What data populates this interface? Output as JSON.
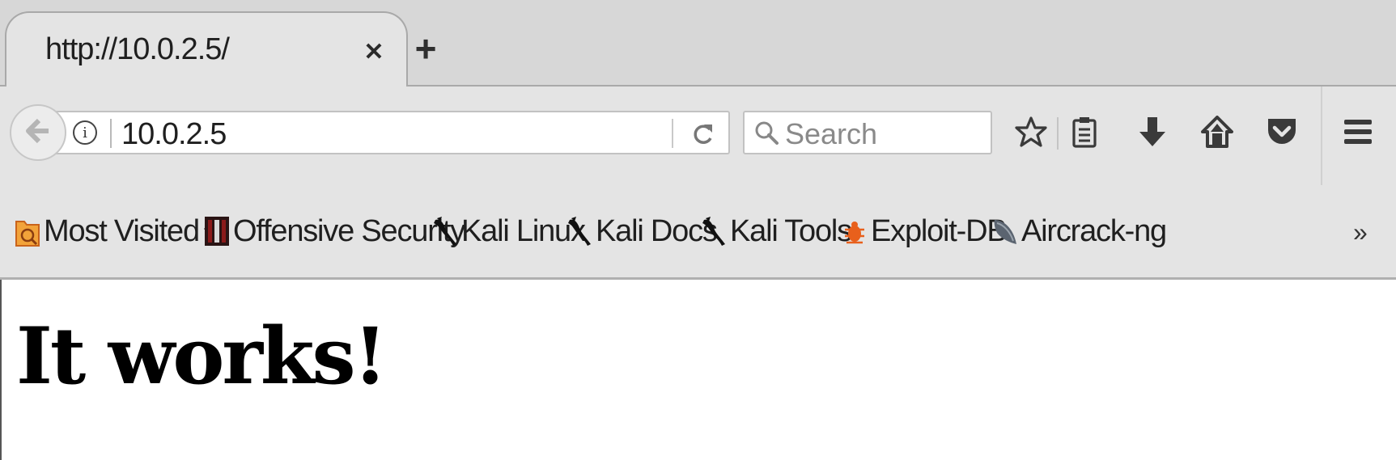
{
  "tab": {
    "title": "http://10.0.2.5/",
    "close_icon": "close-icon",
    "new_tab_icon": "plus-icon"
  },
  "navbar": {
    "url": "10.0.2.5",
    "search_placeholder": "Search",
    "icons": [
      "back-arrow-icon",
      "info-icon",
      "reload-icon",
      "search-icon",
      "star-icon",
      "clipboard-icon",
      "download-icon",
      "home-icon",
      "pocket-icon",
      "hamburger-menu-icon"
    ]
  },
  "bookmarks": {
    "items": [
      {
        "label": "Most Visited",
        "icon": "most-visited-icon"
      },
      {
        "label": "Offensive Security",
        "icon": "offensive-security-icon"
      },
      {
        "label": "Kali Linux",
        "icon": "kali-dragon-icon"
      },
      {
        "label": "Kali Docs",
        "icon": "kali-dragon-icon"
      },
      {
        "label": "Kali Tools",
        "icon": "kali-dragon-icon"
      },
      {
        "label": "Exploit-DB",
        "icon": "exploit-db-bug-icon"
      },
      {
        "label": "Aircrack-ng",
        "icon": "aircrack-icon"
      }
    ],
    "overflow": "»"
  },
  "page": {
    "heading": "It works!"
  },
  "colors": {
    "chrome": "#e4e4e4",
    "tabstrip": "#d7d7d7",
    "exploit_orange": "#e8601c",
    "most_visited_orange": "#e07a1f"
  }
}
